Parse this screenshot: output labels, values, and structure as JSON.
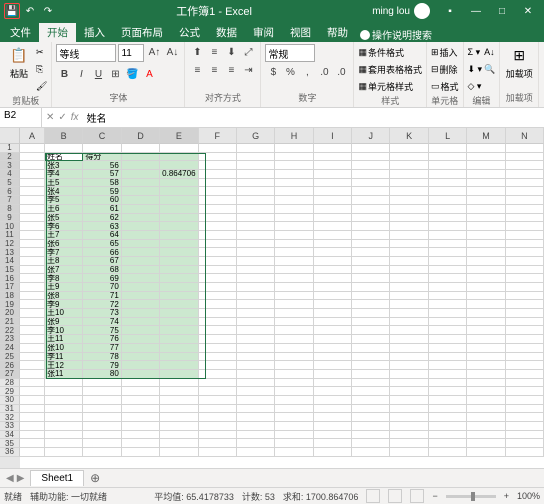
{
  "titlebar": {
    "title": "工作簿1 - Excel",
    "user": "ming lou"
  },
  "tabs": [
    "文件",
    "开始",
    "插入",
    "页面布局",
    "公式",
    "数据",
    "审阅",
    "视图",
    "帮助"
  ],
  "tellme": "操作说明搜索",
  "ribbon": {
    "clipboard": {
      "paste": "粘贴",
      "label": "剪贴板"
    },
    "font": {
      "name": "等线",
      "size": "11",
      "label": "字体"
    },
    "align": {
      "wrap": "常规",
      "label": "对齐方式"
    },
    "number": {
      "format": "常规",
      "label": "数字"
    },
    "styles": {
      "cond": "条件格式",
      "table": "套用表格格式",
      "cell": "单元格样式",
      "label": "样式"
    },
    "cells": {
      "insert": "插入",
      "delete": "删除",
      "format": "格式",
      "label": "单元格"
    },
    "editing": {
      "label": "编辑"
    },
    "addins": {
      "label": "加载项",
      "btn": "加载项"
    }
  },
  "namebox": "B2",
  "formula": "姓名",
  "cols": [
    "A",
    "B",
    "C",
    "D",
    "E",
    "F",
    "G",
    "H",
    "I",
    "J",
    "K",
    "L",
    "M",
    "N"
  ],
  "rows": [
    "1",
    "2",
    "3",
    "4",
    "5",
    "6",
    "7",
    "8",
    "9",
    "10",
    "11",
    "12",
    "13",
    "14",
    "15",
    "16",
    "17",
    "18",
    "19",
    "20",
    "21",
    "22",
    "23",
    "24",
    "25",
    "26",
    "27",
    "28",
    "29",
    "30",
    "31",
    "32",
    "33",
    "34",
    "35",
    "36"
  ],
  "data": {
    "header": {
      "b": "姓名",
      "c": "得分"
    },
    "rows": [
      {
        "b": "张3",
        "c": "56"
      },
      {
        "b": "李4",
        "c": "57"
      },
      {
        "b": "王5",
        "c": "58"
      },
      {
        "b": "张4",
        "c": "59"
      },
      {
        "b": "李5",
        "c": "60"
      },
      {
        "b": "王6",
        "c": "61"
      },
      {
        "b": "张5",
        "c": "62"
      },
      {
        "b": "李6",
        "c": "63"
      },
      {
        "b": "王7",
        "c": "64"
      },
      {
        "b": "张6",
        "c": "65"
      },
      {
        "b": "李7",
        "c": "66"
      },
      {
        "b": "王8",
        "c": "67"
      },
      {
        "b": "张7",
        "c": "68"
      },
      {
        "b": "李8",
        "c": "69"
      },
      {
        "b": "王9",
        "c": "70"
      },
      {
        "b": "张8",
        "c": "71"
      },
      {
        "b": "李9",
        "c": "72"
      },
      {
        "b": "王10",
        "c": "73"
      },
      {
        "b": "张9",
        "c": "74"
      },
      {
        "b": "李10",
        "c": "75"
      },
      {
        "b": "王11",
        "c": "76"
      },
      {
        "b": "张10",
        "c": "77"
      },
      {
        "b": "李11",
        "c": "78"
      },
      {
        "b": "王12",
        "c": "79"
      },
      {
        "b": "张11",
        "c": "80"
      }
    ],
    "e4": "0.864706"
  },
  "sheet": "Sheet1",
  "status": {
    "ready": "就绪",
    "access": "辅助功能: 一切就绪",
    "avg": "平均值: 65.4178733",
    "count": "计数: 53",
    "sum": "求和: 1700.864706",
    "zoom": "100%"
  }
}
